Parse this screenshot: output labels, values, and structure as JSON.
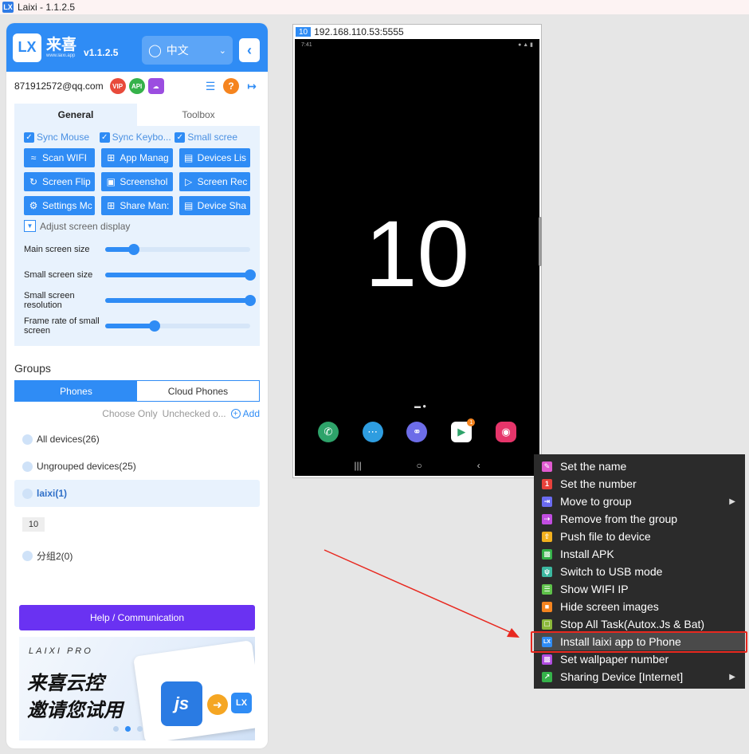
{
  "window": {
    "title": "Laixi - 1.1.2.5",
    "icon_text": "LX"
  },
  "header": {
    "logo_text": "LX",
    "brand_cn": "来喜",
    "brand_site": "www.laixi.app",
    "version": "v1.1.2.5",
    "language": "中文"
  },
  "account": {
    "email": "871912572@qq.com",
    "vip": "VIP",
    "api": "API"
  },
  "tabs": {
    "general": "General",
    "toolbox": "Toolbox"
  },
  "checks": [
    "Sync Mouse",
    "Sync Keybo...",
    "Small scree"
  ],
  "buttons": [
    [
      "Scan WIFI",
      "App Manag",
      "Devices Lis"
    ],
    [
      "Screen Flip",
      "Screenshol",
      "Screen Rec"
    ],
    [
      "Settings Mc",
      "Share Man:",
      "Device Sha"
    ]
  ],
  "adjust_label": "Adjust screen display",
  "sliders": [
    {
      "label": "Main screen size",
      "value": 0.2
    },
    {
      "label": "Small screen size",
      "value": 1.0
    },
    {
      "label": "Small screen resolution",
      "value": 1.0
    },
    {
      "label": "Frame rate of small screen",
      "value": 0.34
    }
  ],
  "groups": {
    "title": "Groups",
    "seg_phones": "Phones",
    "seg_cloud": "Cloud Phones",
    "choose_only": "Choose Only",
    "unchecked": "Unchecked o...",
    "add": "Add",
    "items": [
      "All devices(26)",
      "Ungrouped devices(25)",
      "laixi(1)",
      "分组2(0)"
    ],
    "device_chip": "10"
  },
  "help_button": "Help / Communication",
  "promo": {
    "pro": "LAIXI PRO",
    "line1": "来喜云控",
    "line2": "邀请您试用",
    "js": "js",
    "lx": "LX"
  },
  "phone": {
    "number": "10",
    "address": "192.168.110.53:5555",
    "status_time": "7:41",
    "big_number": "10"
  },
  "context_menu": [
    {
      "label": "Set the name",
      "color": "#e05bd0",
      "submenu": false
    },
    {
      "label": "Set the number",
      "color": "#e8413b",
      "submenu": false
    },
    {
      "label": "Move to group",
      "color": "#6b6bf0",
      "submenu": true
    },
    {
      "label": "Remove from the group",
      "color": "#c14de0",
      "submenu": false
    },
    {
      "label": "Push file to device",
      "color": "#f2b01e",
      "submenu": false
    },
    {
      "label": "Install APK",
      "color": "#35b24a",
      "submenu": false
    },
    {
      "label": "Switch to USB mode",
      "color": "#3bb8a0",
      "submenu": false
    },
    {
      "label": "Show WIFI IP",
      "color": "#5ec24a",
      "submenu": false
    },
    {
      "label": "Hide screen images",
      "color": "#f5841f",
      "submenu": false
    },
    {
      "label": "Stop All Task(Autox.Js & Bat)",
      "color": "#8bb83a",
      "submenu": false
    },
    {
      "label": "Install laixi app to Phone",
      "color": "#2f8cf5",
      "submenu": false
    },
    {
      "label": "Set wallpaper number",
      "color": "#b04de0",
      "submenu": false
    },
    {
      "label": "Sharing Device [Internet]",
      "color": "#35b24a",
      "submenu": true
    }
  ]
}
